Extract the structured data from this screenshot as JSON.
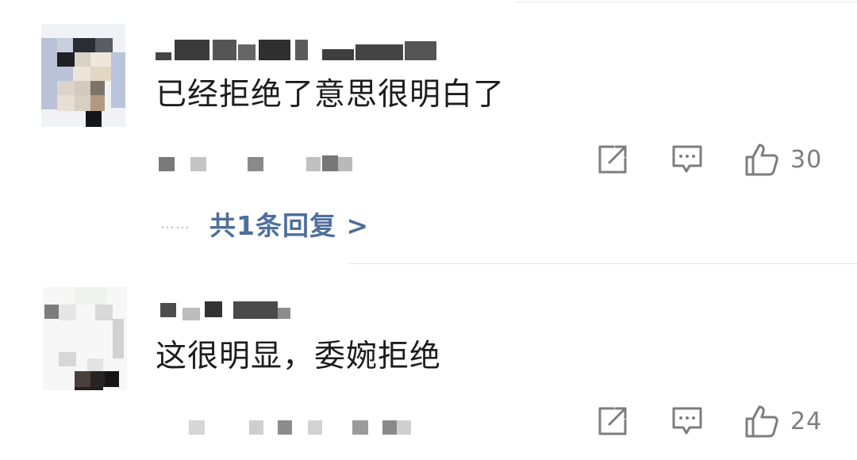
{
  "comments": [
    {
      "text": "已经拒绝了意思很明白了",
      "like_count": "30",
      "replies_label": "……",
      "replies_link": "共1条回复 >"
    },
    {
      "text": "这很明显，委婉拒绝",
      "like_count": "24"
    }
  ],
  "icons": {
    "share": "share-icon",
    "comment": "comment-icon",
    "like": "thumbs-up-icon"
  },
  "colors": {
    "link": "#4f6f9c",
    "icon": "#7d7d7d",
    "text": "#1c1c1c",
    "divider": "#e6e6e6"
  }
}
